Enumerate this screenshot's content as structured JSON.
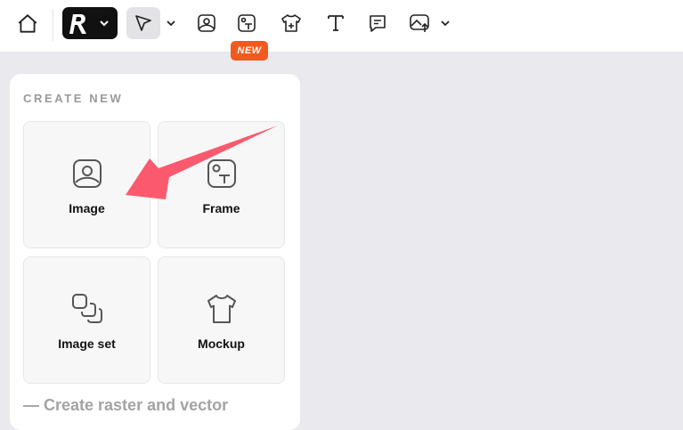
{
  "toolbar": {
    "home": "home-icon",
    "logo": "app-logo",
    "logo_menu": "chevron-down-icon",
    "select_tool": "pointer-arrow-icon",
    "select_menu": "chevron-down-icon",
    "image_tool": "image-icon",
    "frame_tool": "frame-icon",
    "new_badge": "NEW",
    "mockup_tool": "tshirt-icon",
    "text_tool": "text-icon",
    "comment_tool": "comment-icon",
    "upload_tool": "upload-image-icon",
    "upload_menu": "chevron-down-icon"
  },
  "panel": {
    "title": "CREATE NEW",
    "cards": [
      {
        "label": "Image",
        "icon": "image-icon"
      },
      {
        "label": "Frame",
        "icon": "frame-icon"
      },
      {
        "label": "Image set",
        "icon": "image-set-icon"
      },
      {
        "label": "Mockup",
        "icon": "tshirt-icon"
      }
    ],
    "footer": "— Create raster and vector"
  },
  "annotation": {
    "arrow_color": "#fb5a6e"
  },
  "colors": {
    "badge": "#f15a1f",
    "logo_bg": "#111111",
    "canvas_bg": "#e9e9ee"
  }
}
